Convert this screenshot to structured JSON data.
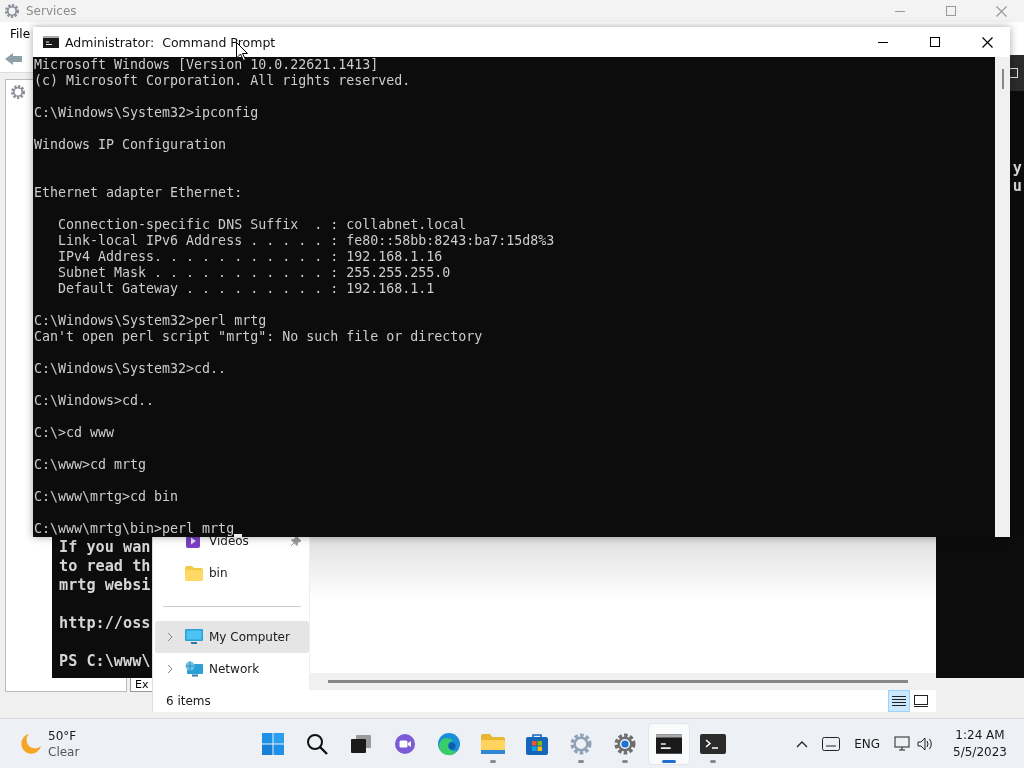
{
  "services_window": {
    "title": "Services",
    "menu": [
      "File"
    ],
    "tab": "Ex"
  },
  "powershell_window": {
    "right_fragments": [
      "y",
      "u"
    ],
    "blocks": [
      {
        "lines": [
          "If you wan",
          "to read th",
          "mrtg websi"
        ]
      },
      {
        "lines": [
          "http://oss"
        ]
      },
      {
        "lines": [
          "PS C:\\www\\"
        ]
      }
    ]
  },
  "cmd_window": {
    "title": "Administrator:  Command Prompt",
    "cursor": true,
    "blocks": [
      {
        "lines": [
          "Microsoft Windows [Version 10.0.22621.1413]",
          "(c) Microsoft Corporation. All rights reserved."
        ]
      },
      {
        "lines": [
          "C:\\Windows\\System32>ipconfig"
        ]
      },
      {
        "lines": [
          "Windows IP Configuration"
        ]
      },
      {
        "lines": [
          "Ethernet adapter Ethernet:"
        ],
        "extra_blank_before": true
      },
      {
        "lines": [
          "   Connection-specific DNS Suffix  . : collabnet.local",
          "   Link-local IPv6 Address . . . . . : fe80::58bb:8243:ba7:15d8%3",
          "   IPv4 Address. . . . . . . . . . . : 192.168.1.16",
          "   Subnet Mask . . . . . . . . . . . : 255.255.255.0",
          "   Default Gateway . . . . . . . . . : 192.168.1.1"
        ]
      },
      {
        "lines": [
          "C:\\Windows\\System32>perl mrtg",
          "Can't open perl script \"mrtg\": No such file or directory"
        ]
      },
      {
        "lines": [
          "C:\\Windows\\System32>cd.."
        ]
      },
      {
        "lines": [
          "C:\\Windows>cd.."
        ]
      },
      {
        "lines": [
          "C:\\>cd www"
        ]
      },
      {
        "lines": [
          "C:\\www>cd mrtg"
        ]
      },
      {
        "lines": [
          "C:\\www\\mrtg>cd bin"
        ]
      },
      {
        "lines": [
          "C:\\www\\mrtg\\bin>perl mrtg"
        ]
      }
    ]
  },
  "explorer_window": {
    "quick_access": [
      {
        "label": "Videos",
        "kind": "videos",
        "pinned": true,
        "selected": false
      },
      {
        "label": "bin",
        "kind": "folder",
        "pinned": false,
        "selected": false
      }
    ],
    "locations": [
      {
        "label": "My Computer",
        "kind": "computer",
        "expandable": true,
        "selected": true
      },
      {
        "label": "Network",
        "kind": "network",
        "expandable": true,
        "selected": false
      }
    ],
    "status": "6 items",
    "view_buttons": [
      {
        "kind": "details",
        "selected": true
      },
      {
        "kind": "tiles",
        "selected": false
      }
    ]
  },
  "taskbar": {
    "weather": {
      "temperature": "50°F",
      "condition": "Clear"
    },
    "apps": [
      {
        "kind": "start",
        "running": false,
        "active": false
      },
      {
        "kind": "search",
        "running": false,
        "active": false
      },
      {
        "kind": "task-view",
        "running": false,
        "active": false
      },
      {
        "kind": "chat",
        "running": false,
        "active": false
      },
      {
        "kind": "edge",
        "running": false,
        "active": false
      },
      {
        "kind": "explorer",
        "running": true,
        "active": false
      },
      {
        "kind": "store",
        "running": false,
        "active": false
      },
      {
        "kind": "services",
        "running": true,
        "active": false
      },
      {
        "kind": "settings",
        "running": true,
        "active": false
      },
      {
        "kind": "cmd",
        "running": true,
        "active": true
      },
      {
        "kind": "terminal",
        "running": true,
        "active": false
      }
    ],
    "tray": {
      "language": "ENG",
      "time": "1:24 AM",
      "date": "5/5/2023"
    }
  }
}
